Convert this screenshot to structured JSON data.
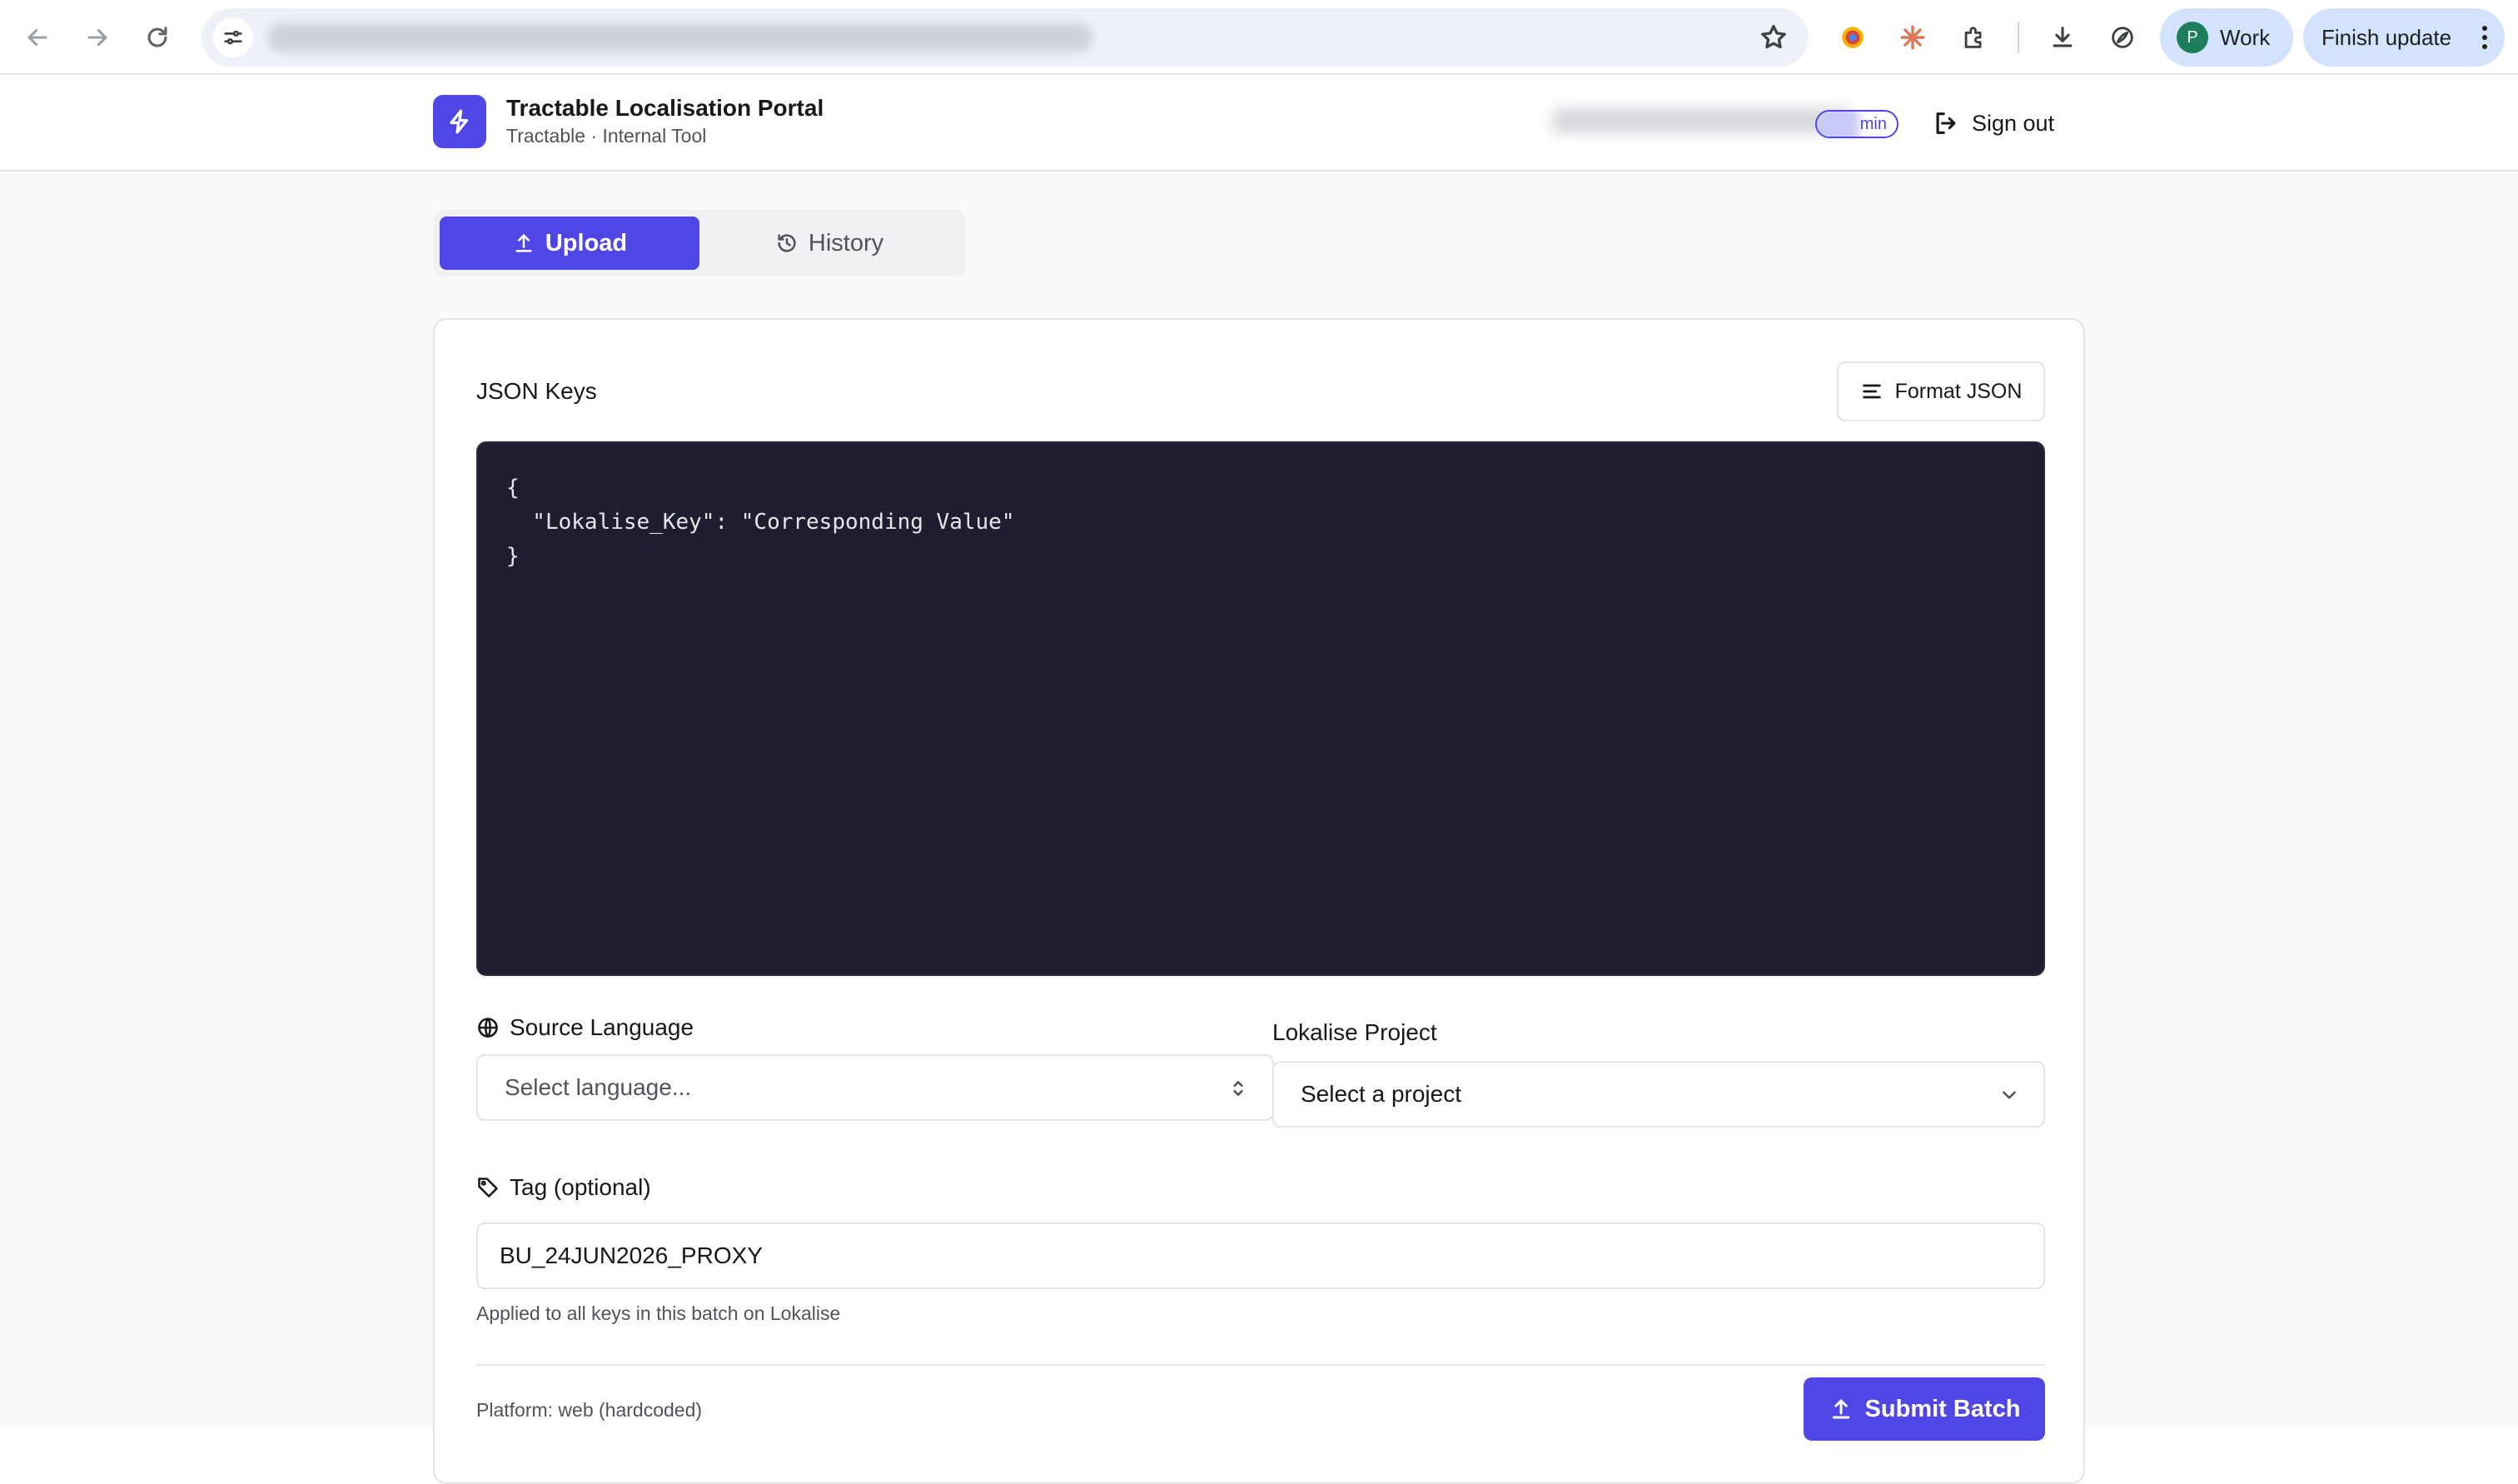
{
  "browser": {
    "profile_initial": "P",
    "profile_name": "Work",
    "update_label": "Finish update"
  },
  "header": {
    "title": "Tractable Localisation Portal",
    "subtitle": "Tractable · Internal Tool",
    "role_badge": "min",
    "signout_label": "Sign out"
  },
  "tabs": [
    {
      "label": "Upload",
      "icon": "upload-icon",
      "active": true
    },
    {
      "label": "History",
      "icon": "history-icon",
      "active": false
    }
  ],
  "json_editor": {
    "label": "JSON Keys",
    "format_button": "Format JSON",
    "content": "{\n  \"Lokalise_Key\": \"Corresponding Value\"\n}"
  },
  "source_language": {
    "label": "Source Language",
    "placeholder": "Select language..."
  },
  "lokalise_project": {
    "label": "Lokalise Project",
    "placeholder": "Select a project"
  },
  "tag": {
    "label": "Tag (optional)",
    "value": "BU_24JUN2026_PROXY",
    "helper": "Applied to all keys in this batch on Lokalise"
  },
  "footer": {
    "platform": "Platform: web (hardcoded)",
    "submit_label": "Submit Batch"
  },
  "colors": {
    "accent": "#4f46e5",
    "editor_bg": "#1e1e2e",
    "border": "#e4e4e7",
    "muted_text": "#52525b"
  }
}
